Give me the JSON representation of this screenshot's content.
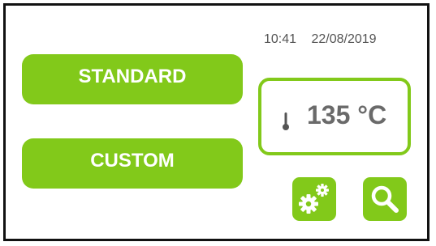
{
  "status": {
    "time": "10:41",
    "date": "22/08/2019"
  },
  "modes": {
    "standard_label": "STANDARD",
    "custom_label": "CUSTOM"
  },
  "temperature": {
    "value": "135 °C",
    "icon": "thermometer-icon"
  },
  "actions": {
    "settings_icon": "gears-icon",
    "search_icon": "magnifier-icon"
  },
  "colors": {
    "accent": "#82c91a",
    "text_dark": "#6a6a6a",
    "frame": "#111111"
  }
}
